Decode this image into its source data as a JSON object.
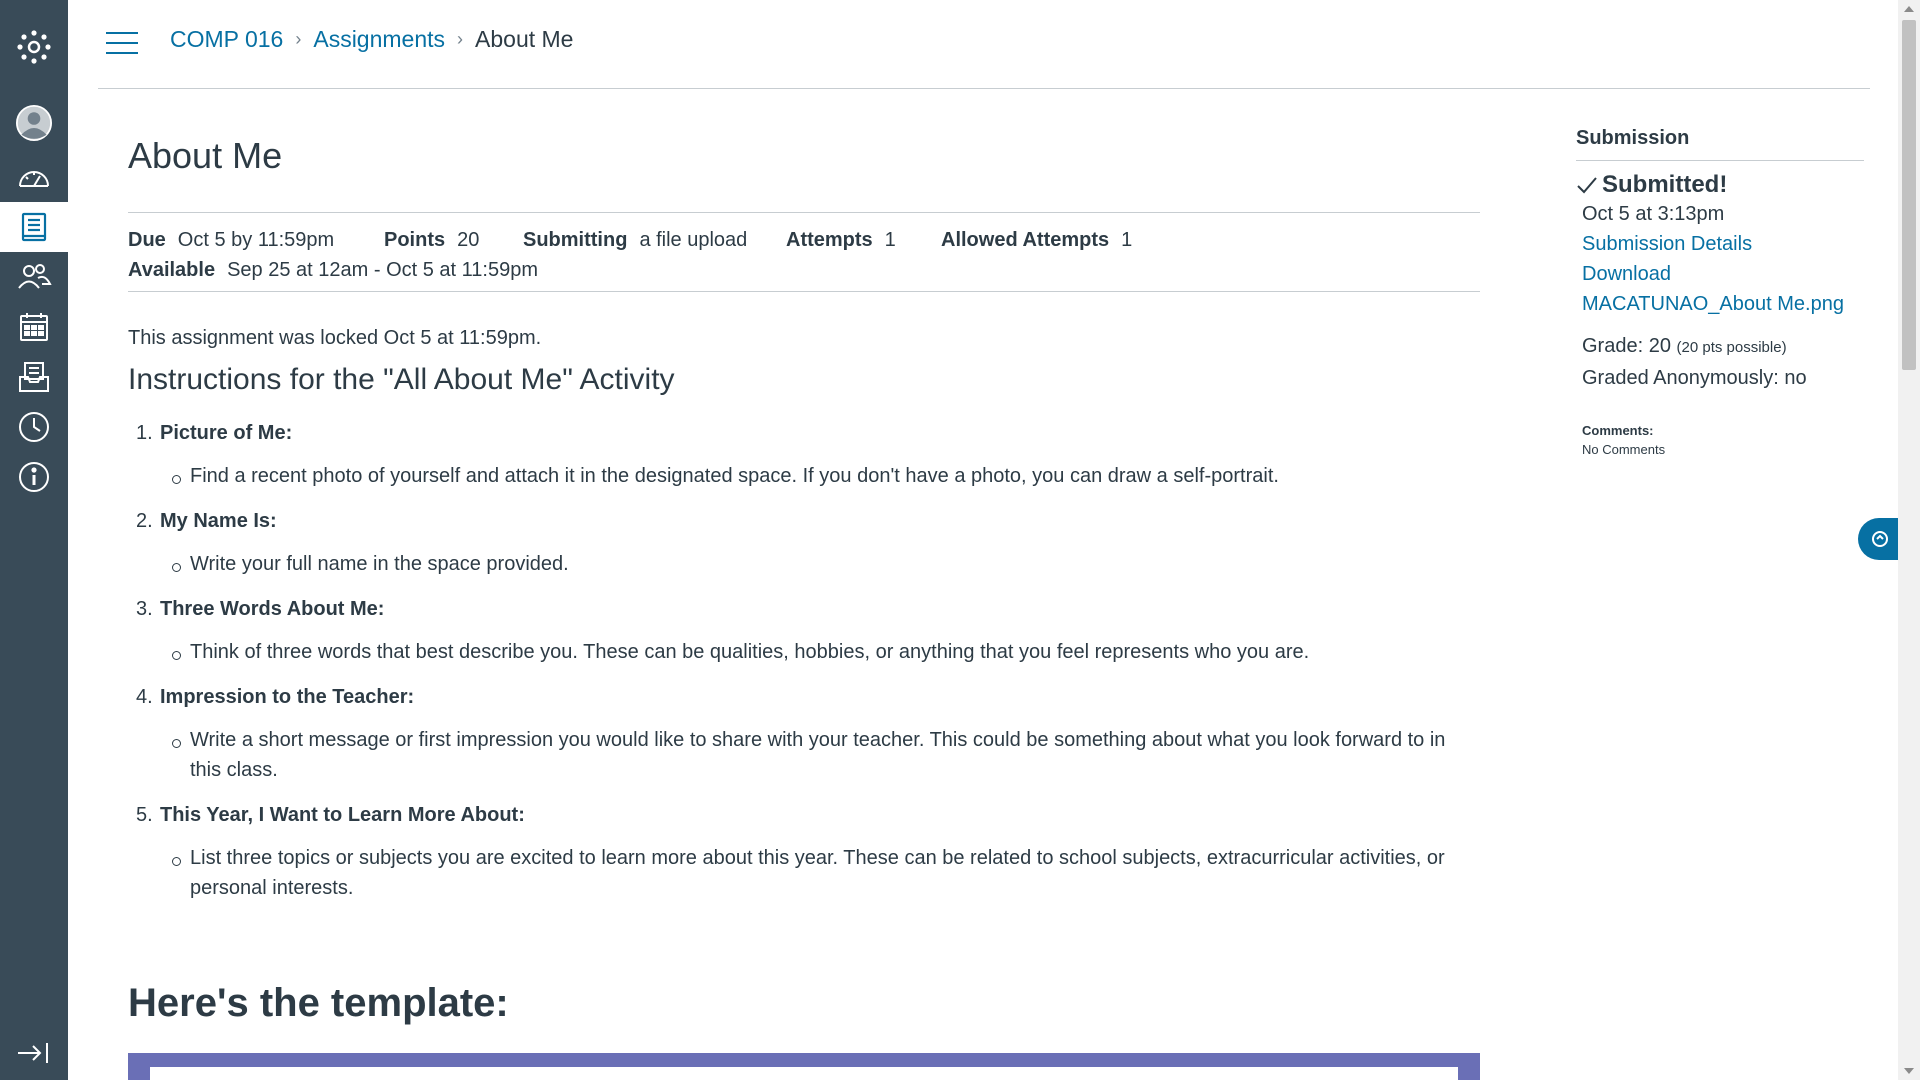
{
  "nav": {
    "items": [
      {
        "name": "logo",
        "icon": "canvas-logo-icon"
      },
      {
        "name": "account",
        "icon": "account-avatar-icon"
      },
      {
        "name": "dashboard",
        "icon": "dashboard-icon"
      },
      {
        "name": "courses",
        "icon": "courses-icon",
        "active": true
      },
      {
        "name": "groups",
        "icon": "groups-icon"
      },
      {
        "name": "calendar",
        "icon": "calendar-icon"
      },
      {
        "name": "inbox",
        "icon": "inbox-icon"
      },
      {
        "name": "history",
        "icon": "history-icon"
      },
      {
        "name": "help",
        "icon": "help-icon"
      }
    ],
    "collapse_icon": "collapse-nav-icon",
    "bg_color": "#394b58"
  },
  "header": {
    "breadcrumb": {
      "course": "COMP 016",
      "section": "Assignments",
      "current": "About Me"
    }
  },
  "assignment": {
    "title": "About Me",
    "details": {
      "due_label": "Due",
      "due_value": "Oct 5 by 11:59pm",
      "points_label": "Points",
      "points_value": "20",
      "submitting_label": "Submitting",
      "submitting_value": "a file upload",
      "attempts_label": "Attempts",
      "attempts_value": "1",
      "allowed_label": "Allowed Attempts",
      "allowed_value": "1",
      "available_label": "Available",
      "available_value": "Sep 25 at 12am - Oct 5 at 11:59pm"
    },
    "locked_message": "This assignment was locked Oct 5 at 11:59pm.",
    "instructions_title": "Instructions for the \"All About Me\" Activity",
    "steps": [
      {
        "num": "1.",
        "title": "Picture of Me:",
        "body": "Find a recent photo of yourself and attach it in the designated space. If you don't have a photo, you can draw a self-portrait."
      },
      {
        "num": "2.",
        "title": "My Name Is:",
        "body": "Write your full name in the space provided."
      },
      {
        "num": "3.",
        "title": "Three Words About Me:",
        "body": "Think of three words that best describe you. These can be qualities, hobbies, or anything that you feel represents who you are."
      },
      {
        "num": "4.",
        "title": "Impression to the Teacher:",
        "body": "Write a short message or first impression you would like to share with your teacher. This could be something about what you look forward to in this class."
      },
      {
        "num": "5.",
        "title": "This Year, I Want to Learn More About:",
        "body": "List three topics or subjects you are excited to learn more about this year. These can be related to school subjects, extracurricular activities, or personal interests."
      }
    ],
    "template_heading": "Here's the template:"
  },
  "submission": {
    "heading": "Submission",
    "status": "Submitted!",
    "submitted_at": "Oct 5 at 3:13pm",
    "details_link": "Submission Details",
    "download_link": "Download",
    "file_link": "MACATUNAO_About Me.png",
    "grade_prefix": "Grade: 20",
    "grade_possible": "(20 pts possible)",
    "graded_anon": "Graded Anonymously: no",
    "comments_label": "Comments:",
    "comments_value": "No Comments"
  },
  "colors": {
    "link": "#0770a3",
    "text": "#2d3b45",
    "template_banner": "#6a6fb6"
  }
}
